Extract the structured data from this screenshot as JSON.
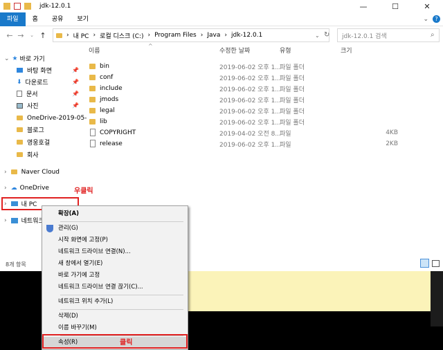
{
  "window": {
    "title": "jdk-12.0.1",
    "minimize": "—",
    "maximize": "☐",
    "close": "✕"
  },
  "ribbon": {
    "tabs": [
      "파일",
      "홈",
      "공유",
      "보기"
    ]
  },
  "address": {
    "up_arrow": "↑",
    "crumbs": [
      "내 PC",
      "로컬 디스크 (C:)",
      "Program Files",
      "Java",
      "jdk-12.0.1"
    ],
    "search_placeholder": "jdk-12.0.1 검색"
  },
  "sidebar": {
    "quick_access": "바로 가기",
    "items": [
      "바탕 화면",
      "다운로드",
      "문서",
      "사진",
      "OneDrive-2019-05-",
      "블로그",
      "영웅호걸",
      "회사"
    ],
    "naver_cloud": "Naver Cloud",
    "onedrive": "OneDrive",
    "this_pc": "내 PC",
    "network": "네트워크"
  },
  "columns": {
    "name": "이름",
    "date": "수정한 날짜",
    "type": "유형",
    "size": "크기"
  },
  "files": [
    {
      "name": "bin",
      "date": "2019-06-02 오후 1...",
      "type": "파일 폴더",
      "size": "",
      "kind": "folder"
    },
    {
      "name": "conf",
      "date": "2019-06-02 오후 1...",
      "type": "파일 폴더",
      "size": "",
      "kind": "folder"
    },
    {
      "name": "include",
      "date": "2019-06-02 오후 1...",
      "type": "파일 폴더",
      "size": "",
      "kind": "folder"
    },
    {
      "name": "jmods",
      "date": "2019-06-02 오후 1...",
      "type": "파일 폴더",
      "size": "",
      "kind": "folder"
    },
    {
      "name": "legal",
      "date": "2019-06-02 오후 1...",
      "type": "파일 폴더",
      "size": "",
      "kind": "folder"
    },
    {
      "name": "lib",
      "date": "2019-06-02 오후 1...",
      "type": "파일 폴더",
      "size": "",
      "kind": "folder"
    },
    {
      "name": "COPYRIGHT",
      "date": "2019-04-02 오전 8...",
      "type": "파일",
      "size": "4KB",
      "kind": "file"
    },
    {
      "name": "release",
      "date": "2019-06-02 오후 1...",
      "type": "파일",
      "size": "2KB",
      "kind": "file"
    }
  ],
  "status": {
    "count": "8개 항목"
  },
  "annotations": {
    "right_click": "우클릭",
    "click": "클릭"
  },
  "context_menu": {
    "expand": "확장(A)",
    "manage": "관리(G)",
    "pin_start": "시작 화면에 고정(P)",
    "map_drive": "네트워크 드라이브 연결(N)...",
    "open_new": "새 창에서 열기(E)",
    "pin_quick": "바로 가기에 고정",
    "disconnect": "네트워크 드라이브 연결 끊기(C)...",
    "add_net_loc": "네트워크 위치 추가(L)",
    "delete": "삭제(D)",
    "rename": "이름 바꾸기(M)",
    "properties": "속성(R)"
  },
  "colors": {
    "accent": "#1979ca",
    "highlight": "#e02020",
    "folder": "#e9b949"
  }
}
